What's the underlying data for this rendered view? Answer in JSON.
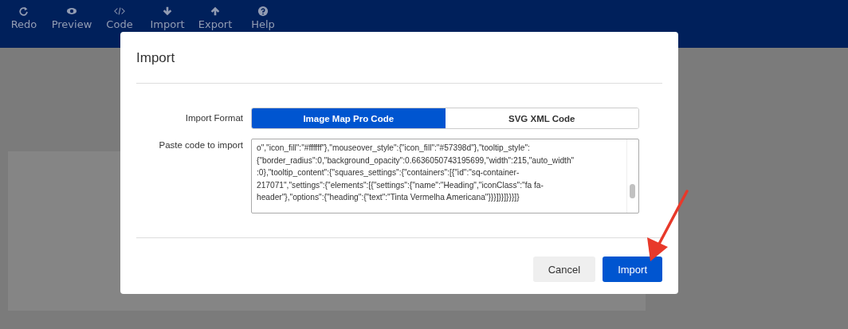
{
  "toolbar": {
    "items": [
      {
        "label": "Redo",
        "kind": "redo"
      },
      {
        "label": "Preview",
        "kind": "preview"
      },
      {
        "label": "Code",
        "kind": "code"
      },
      {
        "label": "Import",
        "kind": "import"
      },
      {
        "label": "Export",
        "kind": "export"
      },
      {
        "label": "Help",
        "kind": "help"
      }
    ]
  },
  "dialog": {
    "title": "Import",
    "format": {
      "label": "Import Format",
      "options": [
        {
          "label": "Image Map Pro Code",
          "selected": true
        },
        {
          "label": "SVG XML Code",
          "selected": false
        }
      ]
    },
    "code": {
      "label": "Paste code to import",
      "value": "o\",\"icon_fill\":\"#ffffff\"},\"mouseover_style\":{\"icon_fill\":\"#57398d\"},\"tooltip_style\":\n{\"border_radius\":0,\"background_opacity\":0.6636050743195699,\"width\":215,\"auto_width\"\n:0},\"tooltip_content\":{\"squares_settings\":{\"containers\":[{\"id\":\"sq-container-\n217071\",\"settings\":{\"elements\":[{\"settings\":{\"name\":\"Heading\",\"iconClass\":\"fa fa-\nheader\"},\"options\":{\"heading\":{\"text\":\"Tinta Vermelha Americana\"}}}]}}]}}}]}"
    },
    "buttons": [
      {
        "label": "Cancel",
        "kind": "secondary"
      },
      {
        "label": "Import",
        "kind": "primary"
      }
    ]
  }
}
